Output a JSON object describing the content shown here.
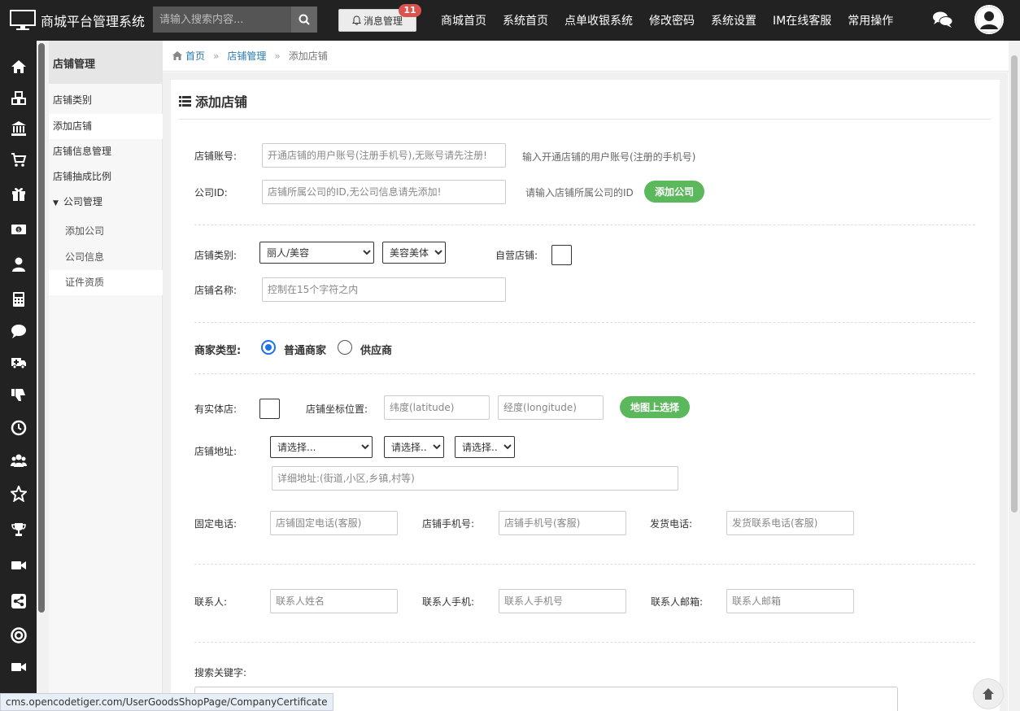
{
  "app": {
    "title": "商城平台管理系统"
  },
  "search": {
    "placeholder": "请输入搜索内容..."
  },
  "messages": {
    "label": "消息管理",
    "count": "11"
  },
  "topnav": [
    "商城首页",
    "系统首页",
    "点单收银系统",
    "修改密码",
    "系统设置",
    "IM在线客服",
    "常用操作"
  ],
  "rail_icons": [
    "home-icon",
    "cubes-icon",
    "bank-icon",
    "cart-icon",
    "gift-icon",
    "money-icon",
    "user-icon",
    "calculator-icon",
    "comment-icon",
    "ambulance-icon",
    "thumbs-down-icon",
    "clock-icon",
    "users-icon",
    "star-icon",
    "trophy-icon",
    "video-icon",
    "share-icon",
    "lifebuoy-icon",
    "video-camera-icon"
  ],
  "submenu": {
    "title": "店铺管理",
    "items": [
      "店铺类别",
      "添加店铺",
      "店铺信息管理",
      "店铺抽成比例",
      "公司管理",
      "添加公司",
      "公司信息",
      "证件资质"
    ]
  },
  "breadcrumb": {
    "home": "首页",
    "parent": "店铺管理",
    "current": "添加店铺"
  },
  "page": {
    "title": "添加店铺"
  },
  "form": {
    "account_label": "店铺账号:",
    "account_placeholder": "开通店铺的用户账号(注册手机号),无账号请先注册!",
    "account_hint": "输入开通店铺的用户账号(注册的手机号)",
    "company_label": "公司ID:",
    "company_placeholder": "店铺所属公司的ID,无公司信息请先添加!",
    "company_hint": "请输入店铺所属公司的ID",
    "add_company": "添加公司",
    "category_label": "店铺类别:",
    "category_1": "丽人/美容",
    "category_2": "美容美体",
    "self_label": "自营店铺:",
    "name_label": "店铺名称:",
    "name_placeholder": "控制在15个字符之内",
    "merchant_label": "商家类型:",
    "merchant_opt1": "普通商家",
    "merchant_opt2": "供应商",
    "physical_label": "有实体店:",
    "coord_label": "店铺坐标位置:",
    "lat_placeholder": "纬度(latitude)",
    "lng_placeholder": "经度(longitude)",
    "map_btn": "地图上选择",
    "addr_label": "店铺地址:",
    "addr_sel1": "请选择...",
    "addr_sel2": "请选择...",
    "addr_sel3": "请选择...",
    "addr_placeholder": "详细地址:(街道,小区,乡镇,村等)",
    "phone_label": "固定电话:",
    "phone_placeholder": "店铺固定电话(客服)",
    "mobile_label": "店铺手机号:",
    "mobile_placeholder": "店铺手机号(客服)",
    "ship_label": "发货电话:",
    "ship_placeholder": "发货联系电话(客服)",
    "contact_label": "联系人:",
    "contact_placeholder": "联系人姓名",
    "contact_mobile_label": "联系人手机:",
    "contact_mobile_placeholder": "联系人手机号",
    "contact_email_label": "联系人邮箱:",
    "contact_email_placeholder": "联系人邮箱",
    "keywords_label": "搜索关键字:"
  },
  "status_url": "cms.opencodetiger.com/UserGoodsShopPage/CompanyCertificate"
}
